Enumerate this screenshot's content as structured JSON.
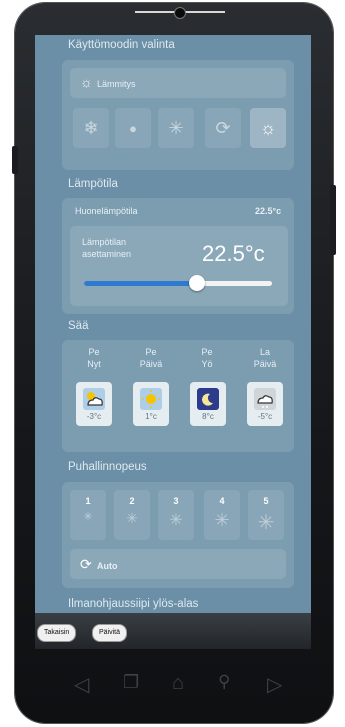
{
  "mode_section": {
    "title": "Käyttömoodin valinta",
    "selected_label": "Lämmitys",
    "modes": [
      {
        "name": "snowflake",
        "glyph": "❄"
      },
      {
        "name": "drop",
        "glyph": "💧"
      },
      {
        "name": "fan",
        "glyph": "✳"
      },
      {
        "name": "auto",
        "glyph": "⟳"
      },
      {
        "name": "sun",
        "glyph": "☼"
      }
    ],
    "active_mode_index": 4
  },
  "temperature_section": {
    "title": "Lämpötila",
    "room_label": "Huonelämpötila",
    "room_value": "22.5°c",
    "setpoint_label": "Lämpötilan asettaminen",
    "setpoint_value": "22.5°c",
    "slider_fraction": 0.6
  },
  "weather_section": {
    "title": "Sää",
    "days": [
      {
        "day": "Pe",
        "time": "Nyt",
        "temp": "-3°c",
        "icon": "cloud-sun-icon"
      },
      {
        "day": "Pe",
        "time": "Päivä",
        "temp": "1°c",
        "icon": "sun-icon"
      },
      {
        "day": "Pe",
        "time": "Yö",
        "temp": "8°c",
        "icon": "moon-icon"
      },
      {
        "day": "La",
        "time": "Päivä",
        "temp": "-5°c",
        "icon": "cloud-snow-icon"
      }
    ]
  },
  "fan_section": {
    "title": "Puhallinnopeus",
    "speeds": [
      "1",
      "2",
      "3",
      "4",
      "5"
    ],
    "auto_label": "Auto"
  },
  "swing_section": {
    "title": "Ilmanohjaussiipi ylös-alas"
  },
  "footer": {
    "back_label": "Takaisin",
    "refresh_label": "Päivitä"
  }
}
